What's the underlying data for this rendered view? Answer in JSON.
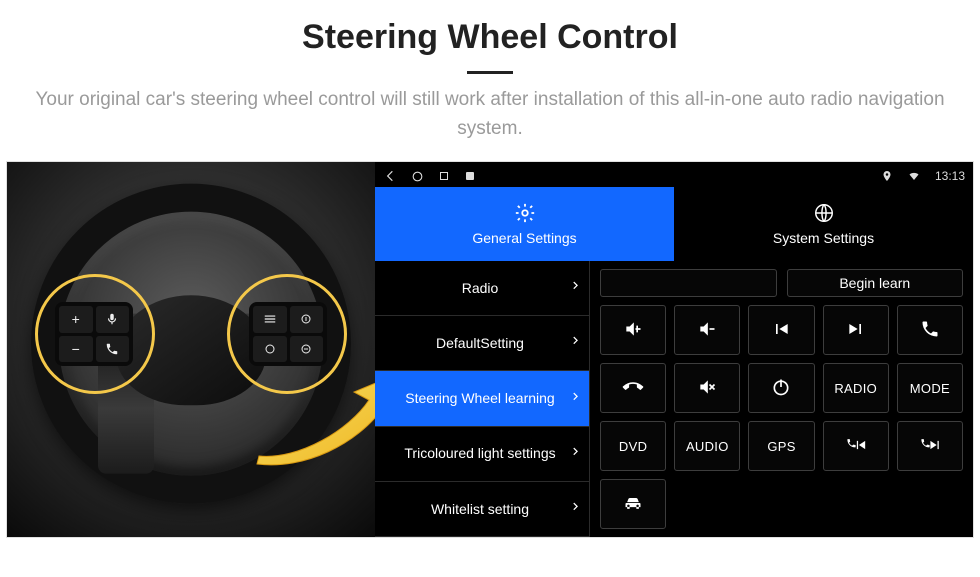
{
  "header": {
    "title": "Steering Wheel Control",
    "subtitle": "Your original car's steering wheel control will still work after installation of this all-in-one auto radio navigation system."
  },
  "status_bar": {
    "time": "13:13"
  },
  "tabs": {
    "general": "General Settings",
    "system": "System Settings"
  },
  "menu": {
    "items": [
      "Radio",
      "DefaultSetting",
      "Steering Wheel learning",
      "Tricoloured light settings",
      "Whitelist setting"
    ],
    "active_index": 2
  },
  "panel": {
    "empty_action": "",
    "begin_learn": "Begin learn",
    "buttons": [
      {
        "kind": "icon",
        "icon": "vol-up"
      },
      {
        "kind": "icon",
        "icon": "vol-down"
      },
      {
        "kind": "icon",
        "icon": "prev"
      },
      {
        "kind": "icon",
        "icon": "next"
      },
      {
        "kind": "icon",
        "icon": "phone"
      },
      {
        "kind": "icon",
        "icon": "hangup"
      },
      {
        "kind": "icon",
        "icon": "mute"
      },
      {
        "kind": "icon",
        "icon": "power"
      },
      {
        "kind": "text",
        "label": "RADIO"
      },
      {
        "kind": "text",
        "label": "MODE"
      },
      {
        "kind": "text",
        "label": "DVD"
      },
      {
        "kind": "text",
        "label": "AUDIO"
      },
      {
        "kind": "text",
        "label": "GPS"
      },
      {
        "kind": "icon",
        "icon": "phone-prev"
      },
      {
        "kind": "icon",
        "icon": "phone-next"
      },
      {
        "kind": "icon",
        "icon": "car"
      }
    ]
  }
}
